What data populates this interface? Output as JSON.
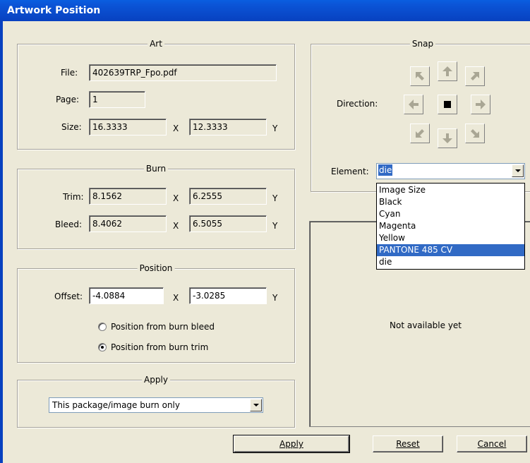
{
  "window": {
    "title": "Artwork Position"
  },
  "art": {
    "legend": "Art",
    "file_label": "File:",
    "file_value": "402639TRP_Fpo.pdf",
    "page_label": "Page:",
    "page_value": "1",
    "size_label": "Size:",
    "size_x": "16.3333",
    "size_y": "12.3333",
    "x_sep": "X",
    "y_suffix": "Y"
  },
  "burn": {
    "legend": "Burn",
    "trim_label": "Trim:",
    "trim_x": "8.1562",
    "trim_y": "6.2555",
    "bleed_label": "Bleed:",
    "bleed_x": "8.4062",
    "bleed_y": "6.5055",
    "x_sep": "X",
    "y_suffix": "Y"
  },
  "position": {
    "legend": "Position",
    "offset_label": "Offset:",
    "offset_x": "-4.0884",
    "offset_y": "-3.0285",
    "x_sep": "X",
    "y_suffix": "Y",
    "radio_bleed": "Position from burn bleed",
    "radio_trim": "Position from burn trim",
    "selected": "trim"
  },
  "apply_group": {
    "legend": "Apply",
    "selected": "This package/image burn only"
  },
  "snap": {
    "legend": "Snap",
    "direction_label": "Direction:",
    "element_label": "Element:",
    "element_value": "die",
    "buttons": [
      "arrow-up-left-icon",
      "arrow-up-icon",
      "arrow-up-right-icon",
      "arrow-left-icon",
      "center-square-icon",
      "arrow-right-icon",
      "arrow-down-left-icon",
      "arrow-down-icon",
      "arrow-down-right-icon"
    ]
  },
  "element_dropdown": {
    "options": [
      "Image Size",
      "Black",
      "Cyan",
      "Magenta",
      "Yellow",
      "PANTONE 485 CV",
      "die"
    ],
    "highlighted": "PANTONE 485 CV"
  },
  "preview": {
    "text": "Not available yet"
  },
  "buttons": {
    "apply": "Apply",
    "reset": "Reset",
    "cancel": "Cancel"
  },
  "colors": {
    "title_bar": "#0841c0",
    "highlight": "#316ac5",
    "dialog_bg": "#ece9d8"
  }
}
